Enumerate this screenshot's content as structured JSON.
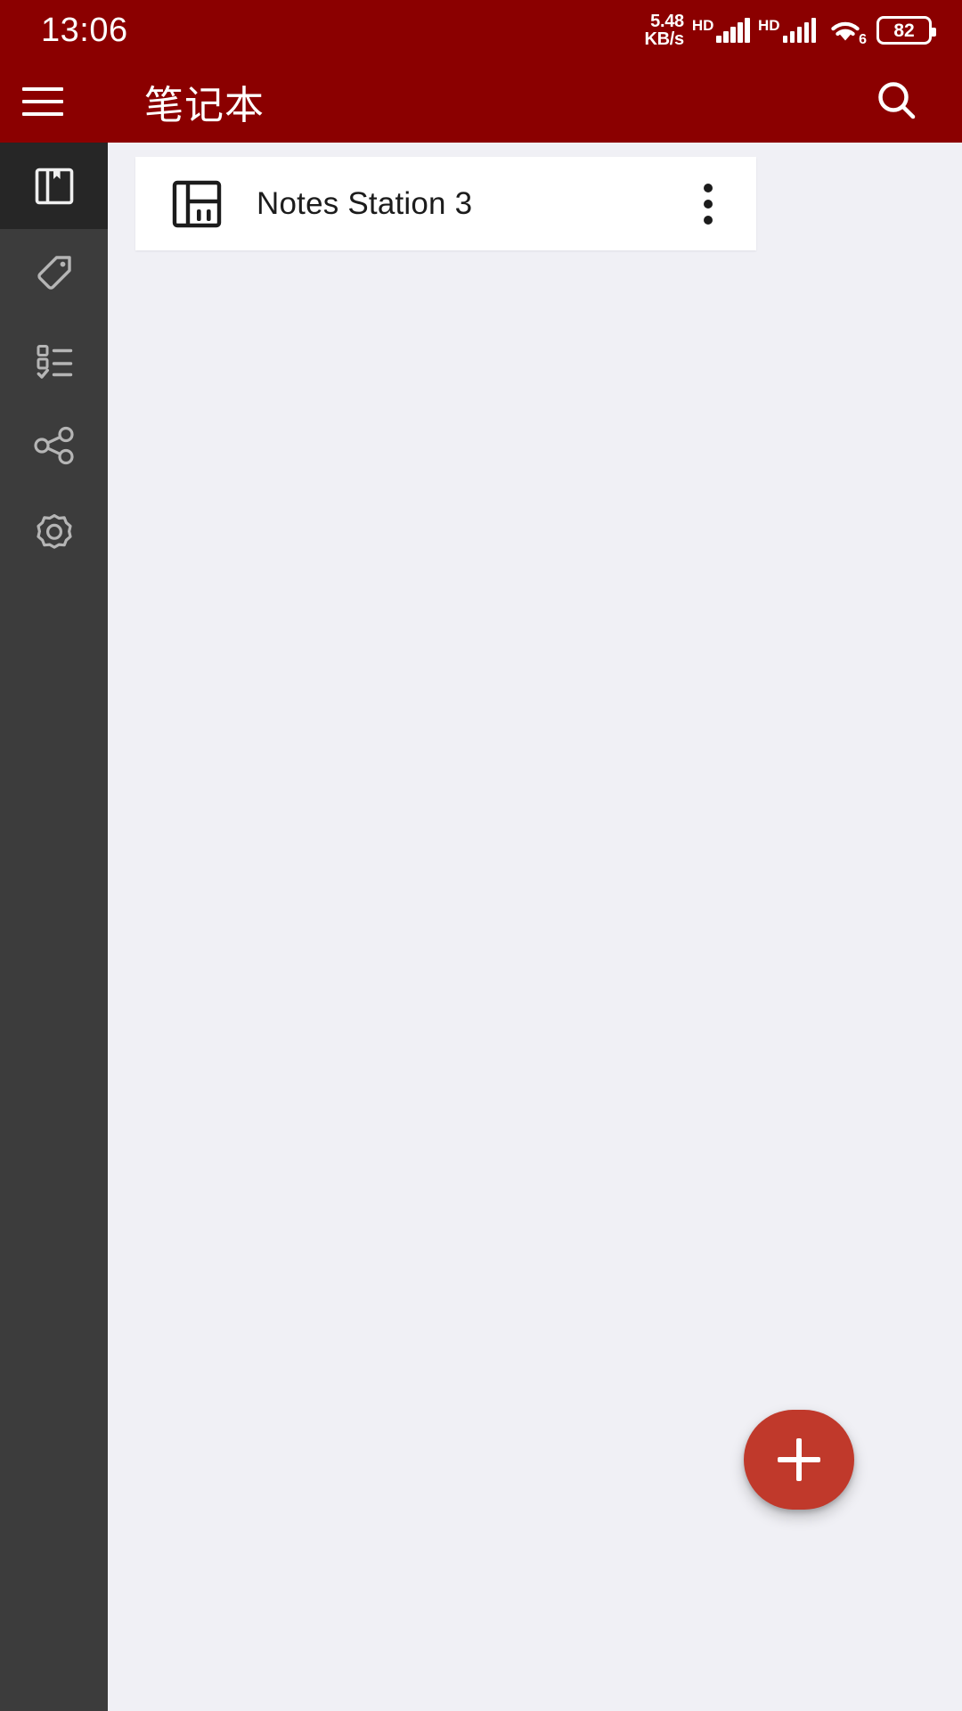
{
  "statusbar": {
    "time": "13:06",
    "network_speed_value": "5.48",
    "network_speed_unit": "KB/s",
    "sim1_label": "HD",
    "sim2_label": "HD",
    "wifi_generation": "6",
    "battery_percent": "82",
    "icons": {
      "signal": "signal-bars-icon",
      "wifi": "wifi-icon",
      "battery": "battery-icon"
    }
  },
  "appbar": {
    "menu_icon": "hamburger-menu-icon",
    "title": "笔记本",
    "search_icon": "search-icon",
    "background_color": "#8b0000"
  },
  "rail": {
    "background_color": "#3c3c3c",
    "active_background_color": "#262626",
    "items": [
      {
        "name": "notebooks",
        "icon": "notebook-icon",
        "active": true
      },
      {
        "name": "tags",
        "icon": "tag-icon",
        "active": false
      },
      {
        "name": "todo",
        "icon": "checklist-icon",
        "active": false
      },
      {
        "name": "shared",
        "icon": "share-icon",
        "active": false
      },
      {
        "name": "settings",
        "icon": "gear-icon",
        "active": false
      }
    ]
  },
  "content": {
    "background_color": "#f0f0f5",
    "notebooks": [
      {
        "icon": "notebook-icon",
        "title": "Notes Station 3",
        "more_icon": "more-vertical-icon"
      }
    ]
  },
  "fab": {
    "icon": "plus-icon",
    "color": "#c0392b"
  }
}
